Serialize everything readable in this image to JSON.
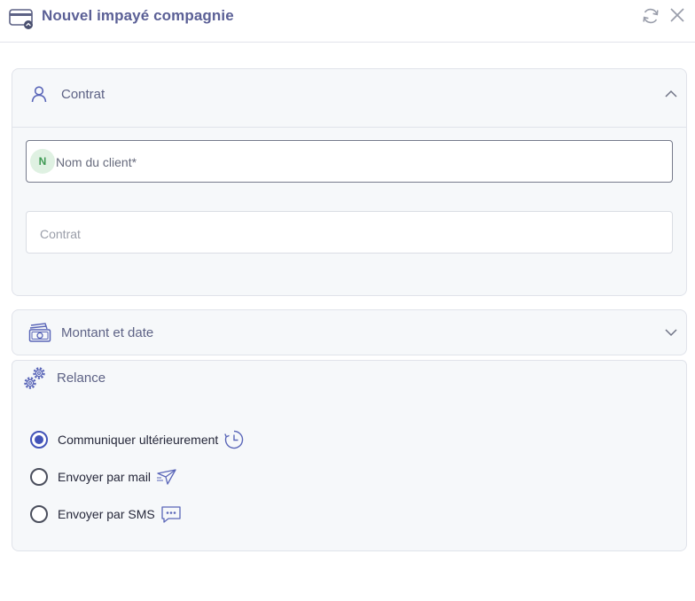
{
  "header": {
    "title": "Nouvel impayé compagnie",
    "icon": "credit-card-icon",
    "actions": [
      "refresh-icon",
      "close-icon"
    ]
  },
  "contrat_section": {
    "title": "Contrat",
    "icon": "user-icon",
    "expanded": true,
    "client_avatar": "N",
    "client_placeholder": "Nom du client*",
    "contrat_placeholder": "Contrat"
  },
  "montant_section": {
    "title": "Montant et date",
    "icon": "money-icon",
    "expanded": false
  },
  "relance_section": {
    "title": "Relance",
    "icon": "gears-icon",
    "options": [
      {
        "label": "Communiquer ultérieurement",
        "selected": true,
        "icon": "clock-icon"
      },
      {
        "label": "Envoyer par mail",
        "selected": false,
        "icon": "send-icon"
      },
      {
        "label": "Envoyer par SMS",
        "selected": false,
        "icon": "sms-icon"
      }
    ]
  },
  "colors": {
    "accent": "#4253b8",
    "title": "#5b6096",
    "icon": "#5a66b8",
    "panel_bg": "#f6f8fa",
    "avatar_bg": "#dff1e2",
    "avatar_fg": "#3f9a54"
  }
}
